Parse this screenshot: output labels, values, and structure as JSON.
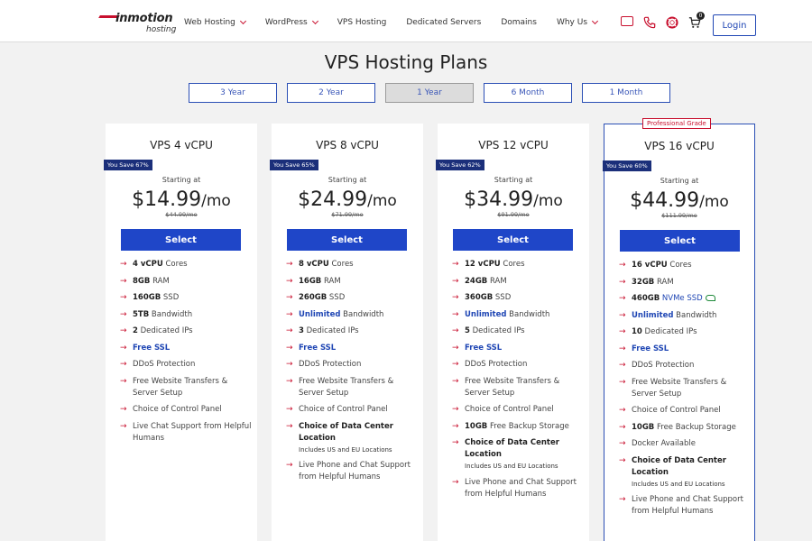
{
  "header": {
    "logo_brand": "inmotion",
    "logo_sub": "hosting",
    "nav": [
      {
        "label": "Web Hosting",
        "dropdown": true
      },
      {
        "label": "WordPress",
        "dropdown": true
      },
      {
        "label": "VPS Hosting",
        "dropdown": false
      },
      {
        "label": "Dedicated Servers",
        "dropdown": false
      },
      {
        "label": "Domains",
        "dropdown": false
      },
      {
        "label": "Why Us",
        "dropdown": true
      }
    ],
    "icons": [
      "chat-icon",
      "phone-icon",
      "lifebuoy-icon",
      "cart-icon"
    ],
    "cart_count": "0",
    "login_label": "Login"
  },
  "page_title": "VPS Hosting Plans",
  "terms": [
    "3 Year",
    "2 Year",
    "1 Year",
    "6 Month",
    "1 Month"
  ],
  "active_term": "1 Year",
  "colors": {
    "accent": "#c8102e",
    "primary": "#1f46c8",
    "badge": "#1b2f7a"
  },
  "plans": [
    {
      "name": "VPS 4 vCPU",
      "save": "You Save 67%",
      "starting": "Starting at",
      "price": "$14.99",
      "per": "/mo",
      "original": "$44.99/mo",
      "select_label": "Select"
    },
    {
      "name": "VPS 8 vCPU",
      "save": "You Save 65%",
      "starting": "Starting at",
      "price": "$24.99",
      "per": "/mo",
      "original": "$71.99/mo",
      "select_label": "Select"
    },
    {
      "name": "VPS 12 vCPU",
      "save": "You Save 62%",
      "starting": "Starting at",
      "price": "$34.99",
      "per": "/mo",
      "original": "$91.99/mo",
      "select_label": "Select"
    },
    {
      "name": "VPS 16 vCPU",
      "badge": "Professional Grade",
      "save": "You Save 60%",
      "starting": "Starting at",
      "price": "$44.99",
      "per": "/mo",
      "original": "$111.99/mo",
      "select_label": "Select"
    }
  ],
  "features": {
    "p0": [
      {
        "bold": "4 vCPU",
        "text": " Cores"
      },
      {
        "bold": "8GB",
        "text": " RAM"
      },
      {
        "bold": "160GB",
        "text": " SSD"
      },
      {
        "bold": "5TB",
        "text": " Bandwidth"
      },
      {
        "bold": "2",
        "text": " Dedicated IPs"
      },
      {
        "blue": "Free SSL"
      },
      {
        "text": "DDoS Protection"
      },
      {
        "text": "Free Website Transfers & Server Setup"
      },
      {
        "text": "Choice of Control Panel"
      },
      {
        "text": "Live Chat Support from Helpful Humans"
      }
    ],
    "p1": [
      {
        "bold": "8 vCPU",
        "text": " Cores"
      },
      {
        "bold": "16GB",
        "text": " RAM"
      },
      {
        "bold": "260GB",
        "text": " SSD"
      },
      {
        "blue": "Unlimited",
        "text": " Bandwidth"
      },
      {
        "bold": "3",
        "text": " Dedicated IPs"
      },
      {
        "blue": "Free SSL"
      },
      {
        "text": "DDoS Protection"
      },
      {
        "text": "Free Website Transfers & Server Setup"
      },
      {
        "text": "Choice of Control Panel"
      },
      {
        "bold": "Choice of Data Center Location",
        "small": "Includes US and EU Locations"
      },
      {
        "text": "Live Phone and Chat Support from Helpful Humans"
      }
    ],
    "p2": [
      {
        "bold": "12 vCPU",
        "text": " Cores"
      },
      {
        "bold": "24GB",
        "text": " RAM"
      },
      {
        "bold": "360GB",
        "text": " SSD"
      },
      {
        "blue": "Unlimited",
        "text": " Bandwidth"
      },
      {
        "bold": "5",
        "text": " Dedicated IPs"
      },
      {
        "blue": "Free SSL"
      },
      {
        "text": "DDoS Protection"
      },
      {
        "text": "Free Website Transfers & Server Setup"
      },
      {
        "text": "Choice of Control Panel"
      },
      {
        "bold": "10GB",
        "text": " Free Backup Storage"
      },
      {
        "bold": "Choice of Data Center Location",
        "small": "Includes US and EU Locations"
      },
      {
        "text": "Live Phone and Chat Support from Helpful Humans"
      }
    ],
    "p3": [
      {
        "bold": "16 vCPU",
        "text": " Cores"
      },
      {
        "bold": "32GB",
        "text": " RAM"
      },
      {
        "bold": "460GB",
        "nvme": " NVMe SSD"
      },
      {
        "blue": "Unlimited",
        "text": " Bandwidth"
      },
      {
        "bold": "10",
        "text": " Dedicated IPs"
      },
      {
        "blue": "Free SSL"
      },
      {
        "text": "DDoS Protection"
      },
      {
        "text": "Free Website Transfers & Server Setup"
      },
      {
        "text": "Choice of Control Panel"
      },
      {
        "bold": "10GB",
        "text": " Free Backup Storage"
      },
      {
        "text": "Docker Available"
      },
      {
        "bold": "Choice of Data Center Location",
        "small": "Includes US and EU Locations"
      },
      {
        "text": "Live Phone and Chat Support from Helpful Humans"
      }
    ]
  }
}
